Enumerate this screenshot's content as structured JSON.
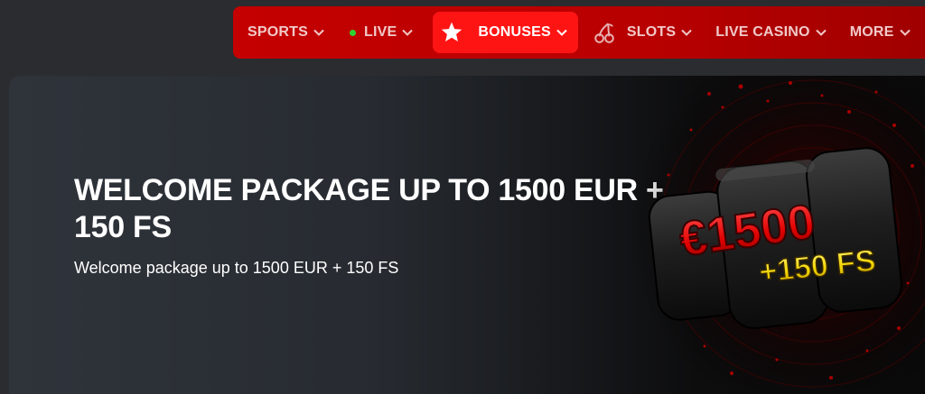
{
  "nav": {
    "items": [
      {
        "label": "SPORTS"
      },
      {
        "label": "LIVE"
      },
      {
        "label": "BONUSES"
      },
      {
        "label": "SLOTS"
      },
      {
        "label": "LIVE CASINO"
      },
      {
        "label": "MORE"
      }
    ]
  },
  "banner": {
    "title": "WELCOME PACKAGE UP TO 1500 EUR + 150 FS",
    "subtitle": "Welcome package up to 1500 EUR + 150 FS",
    "art_amount": "€1500",
    "art_spins": "+150 FS"
  },
  "colors": {
    "nav_bg": "#c40000",
    "active_bg": "#ff1414",
    "live_dot": "#2fd42f",
    "art_gold": "#f2d400",
    "art_red": "#e00000"
  }
}
